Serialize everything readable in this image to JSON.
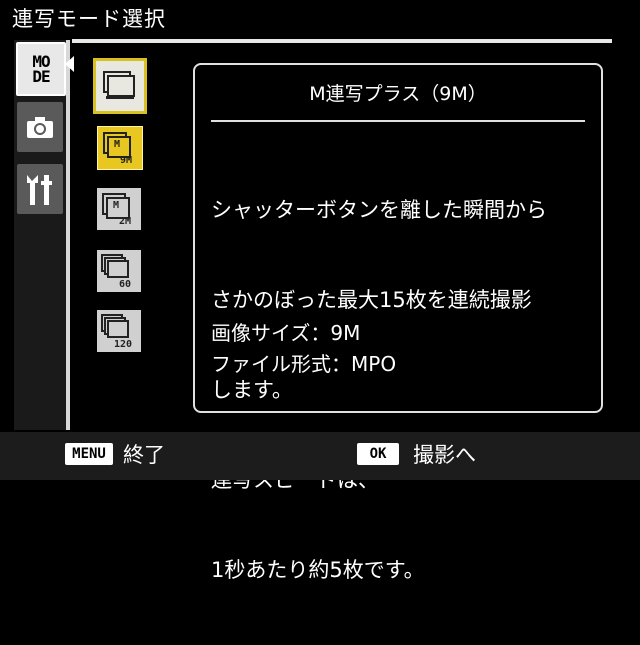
{
  "header": {
    "title": "連写モード選択"
  },
  "tabs": [
    {
      "label": "MO\nDE",
      "line1": "MO",
      "line2": "DE",
      "state": "active"
    },
    {
      "icon": "camera-icon",
      "state": "inactive"
    },
    {
      "icon": "wrench-settings-icon",
      "state": "inactive"
    }
  ],
  "modes": [
    {
      "icon": "continuous-icon",
      "state": "selected"
    },
    {
      "icon": "m-continuous-plus-9m-icon",
      "top_label": "M",
      "sub_label": "9M",
      "state": "highlighted"
    },
    {
      "icon": "m-continuous-plus-2m-icon",
      "top_label": "M",
      "sub_label": "2M",
      "state": "normal"
    },
    {
      "icon": "speed-continuous-60-icon",
      "sub_label": "60",
      "state": "normal"
    },
    {
      "icon": "speed-continuous-120-icon",
      "sub_label": "120",
      "state": "normal"
    }
  ],
  "info": {
    "title": "M連写プラス（9M）",
    "description_lines": [
      "シャッターボタンを離した瞬間から",
      "さかのぼった最大15枚を連続撮影",
      "します。",
      "連写スピードは、",
      "1秒あたり約5枚です。"
    ],
    "image_size": "画像サイズ：9M",
    "file_format": "ファイル形式：MPO"
  },
  "footer": {
    "menu_key": "MENU",
    "menu_label": "終了",
    "ok_key": "OK",
    "ok_label": "撮影へ"
  },
  "colors": {
    "background": "#000000",
    "highlight_gold": "#e8c820",
    "selected_border": "#d8c020",
    "text": "#ffffff"
  }
}
